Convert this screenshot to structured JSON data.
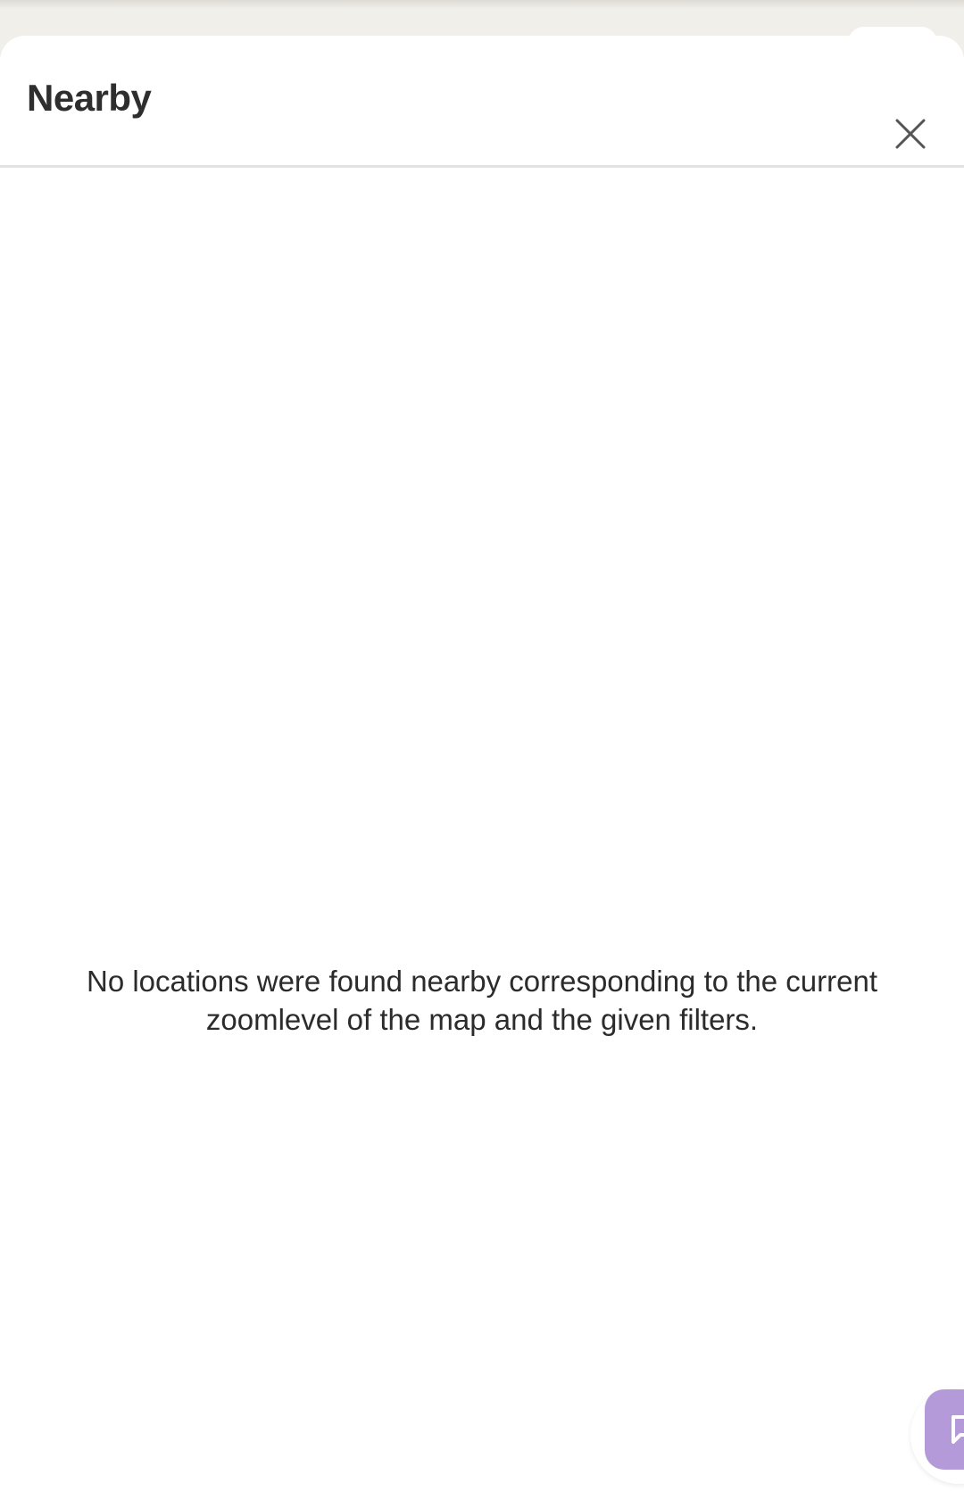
{
  "sheet": {
    "title": "Nearby",
    "close_icon": "close-icon",
    "empty_message": "No locations were found nearby corresponding to the current zoomlevel of the map and the given filters."
  },
  "chat_button": {
    "icon": "chat-bubble-icon",
    "color": "#b49ad9"
  }
}
